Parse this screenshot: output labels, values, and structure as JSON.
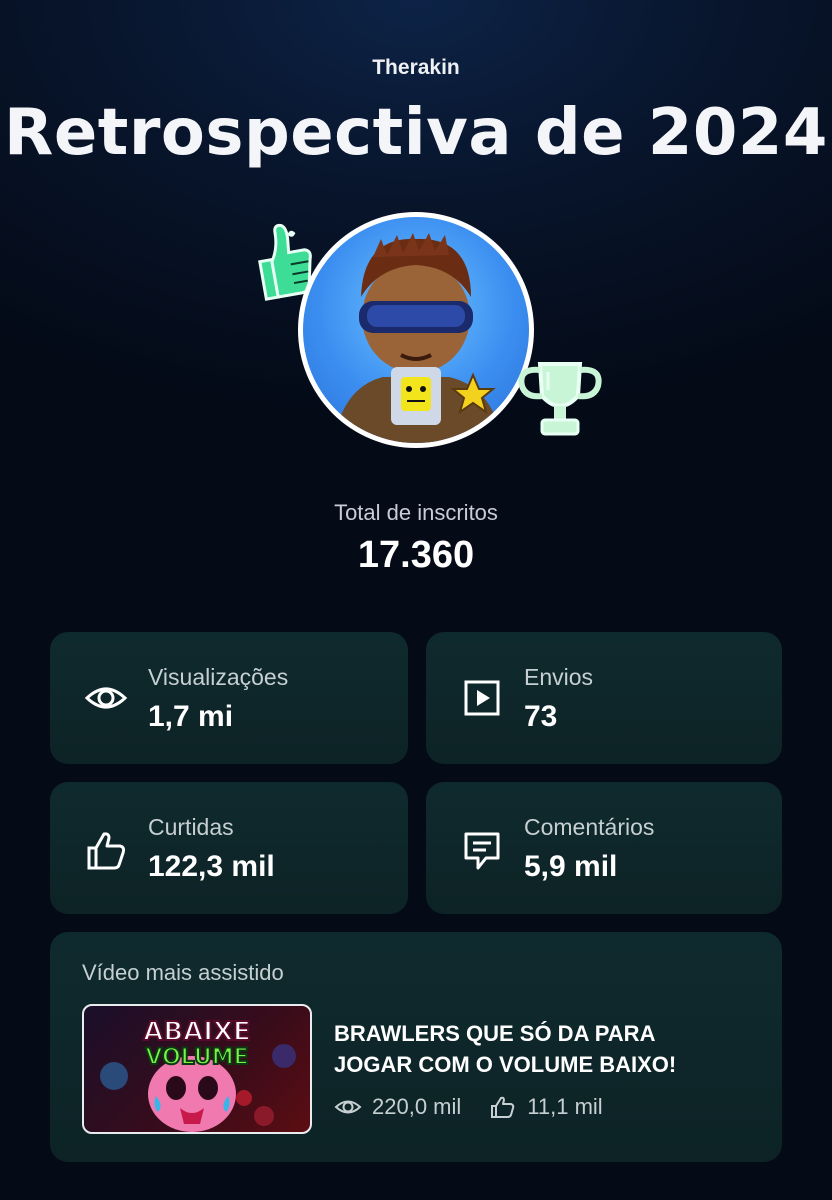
{
  "header": {
    "channel_name": "Therakin",
    "title": "Retrospectiva de 2024"
  },
  "subscribers": {
    "label": "Total de inscritos",
    "value": "17.360"
  },
  "stats": {
    "views": {
      "label": "Visualizações",
      "value": "1,7 mi",
      "icon": "eye-icon"
    },
    "uploads": {
      "label": "Envios",
      "value": "73",
      "icon": "play-icon"
    },
    "likes": {
      "label": "Curtidas",
      "value": "122,3 mil",
      "icon": "thumbs-up-icon"
    },
    "comments": {
      "label": "Comentários",
      "value": "5,9 mil",
      "icon": "comment-icon"
    }
  },
  "top_video": {
    "section_label": "Vídeo mais assistido",
    "thumbnail_text_1": "ABAIXE",
    "thumbnail_text_2": "VOLUME",
    "title_line_1": "BRAWLERS QUE SÓ DA PARA",
    "title_line_2": "JOGAR COM O VOLUME BAIXO!",
    "views": "220,0 mil",
    "likes": "11,1 mil"
  },
  "colors": {
    "card_bg": "#0f2a2e",
    "sticker_green": "#3ddc97",
    "avatar_blue": "#3b8ef0"
  }
}
